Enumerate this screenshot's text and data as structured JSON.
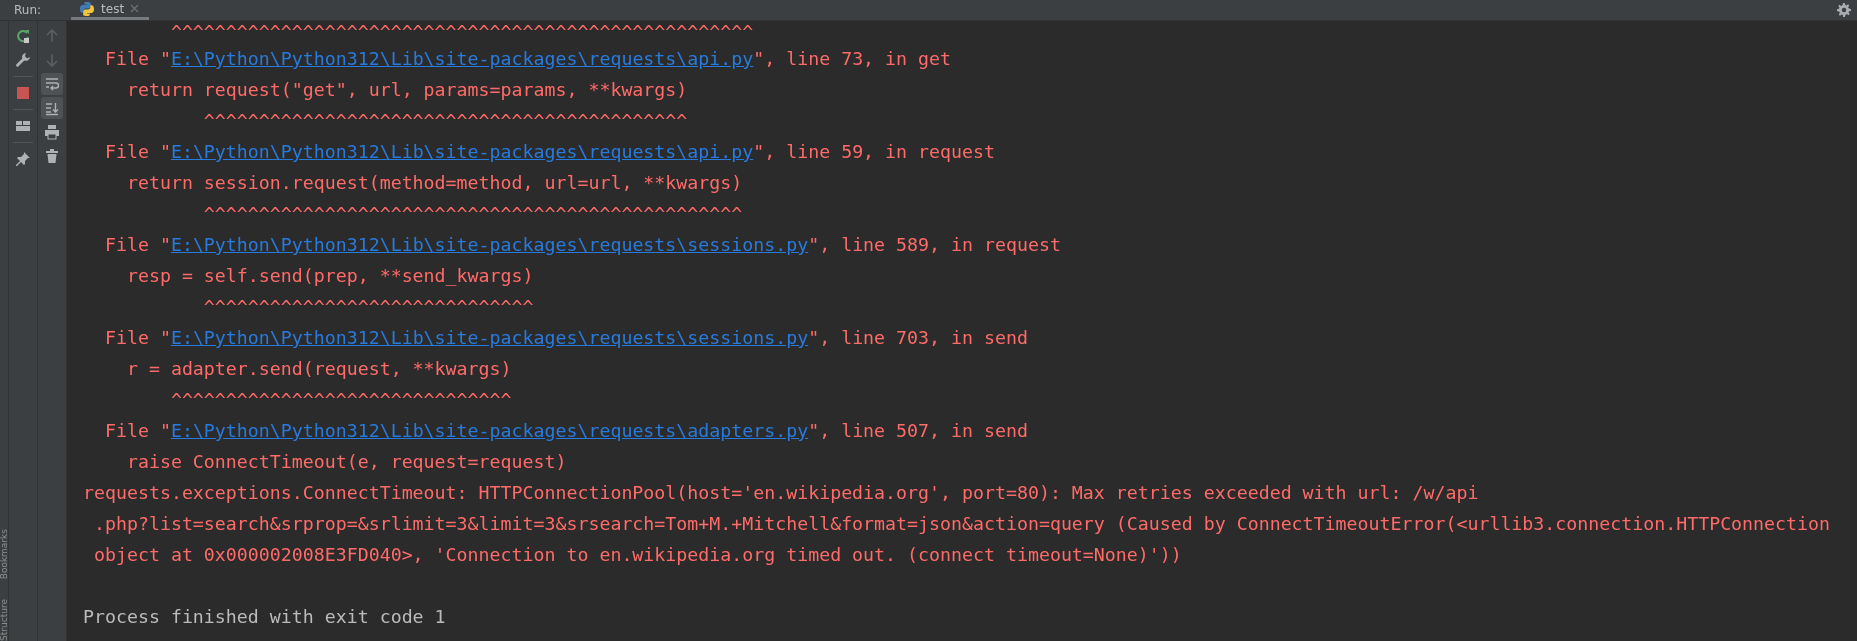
{
  "run_bar": {
    "label": "Run:",
    "tabs": [
      {
        "label": "test",
        "selected": true
      }
    ]
  },
  "toolbar_2": [
    {
      "disabled": true,
      "selected": false
    },
    {
      "disabled": true,
      "selected": false
    },
    {
      "disabled": false,
      "selected": true
    },
    {
      "disabled": false,
      "selected": true
    },
    {
      "disabled": false,
      "selected": false
    },
    {
      "disabled": false,
      "selected": false
    }
  ],
  "side_stripe": [
    "Bookmarks",
    "Structure"
  ],
  "console": [
    {
      "kind": "error",
      "text": "        ^^^^^^^^^^^^^^^^^^^^^^^^^^^^^^^^^^^^^^^^^^^^^^^^^^^^^"
    },
    {
      "kind": "trace",
      "before": "  File \"",
      "link": "E:\\Python\\Python312\\Lib\\site-packages\\requests\\api.py",
      "after": "\", line 73, in get"
    },
    {
      "kind": "error",
      "text": "    return request(\"get\", url, params=params, **kwargs)"
    },
    {
      "kind": "error",
      "text": "           ^^^^^^^^^^^^^^^^^^^^^^^^^^^^^^^^^^^^^^^^^^^^"
    },
    {
      "kind": "trace",
      "before": "  File \"",
      "link": "E:\\Python\\Python312\\Lib\\site-packages\\requests\\api.py",
      "after": "\", line 59, in request"
    },
    {
      "kind": "error",
      "text": "    return session.request(method=method, url=url, **kwargs)"
    },
    {
      "kind": "error",
      "text": "           ^^^^^^^^^^^^^^^^^^^^^^^^^^^^^^^^^^^^^^^^^^^^^^^^^"
    },
    {
      "kind": "trace",
      "before": "  File \"",
      "link": "E:\\Python\\Python312\\Lib\\site-packages\\requests\\sessions.py",
      "after": "\", line 589, in request"
    },
    {
      "kind": "error",
      "text": "    resp = self.send(prep, **send_kwargs)"
    },
    {
      "kind": "error",
      "text": "           ^^^^^^^^^^^^^^^^^^^^^^^^^^^^^^"
    },
    {
      "kind": "trace",
      "before": "  File \"",
      "link": "E:\\Python\\Python312\\Lib\\site-packages\\requests\\sessions.py",
      "after": "\", line 703, in send"
    },
    {
      "kind": "error",
      "text": "    r = adapter.send(request, **kwargs)"
    },
    {
      "kind": "error",
      "text": "        ^^^^^^^^^^^^^^^^^^^^^^^^^^^^^^^"
    },
    {
      "kind": "trace",
      "before": "  File \"",
      "link": "E:\\Python\\Python312\\Lib\\site-packages\\requests\\adapters.py",
      "after": "\", line 507, in send"
    },
    {
      "kind": "error",
      "text": "    raise ConnectTimeout(e, request=request)"
    },
    {
      "kind": "error",
      "text": "requests.exceptions.ConnectTimeout: HTTPConnectionPool(host='en.wikipedia.org', port=80): Max retries exceeded with url: /w/api"
    },
    {
      "kind": "error",
      "text": " .php?list=search&srprop=&srlimit=3&limit=3&srsearch=Tom+M.+Mitchell&format=json&action=query (Caused by ConnectTimeoutError(<urllib3.connection.HTTPConnection"
    },
    {
      "kind": "error",
      "text": " object at 0x000002008E3FD040>, 'Connection to en.wikipedia.org timed out. (connect timeout=None)'))"
    },
    {
      "kind": "blank"
    },
    {
      "kind": "info",
      "text": "Process finished with exit code 1"
    }
  ]
}
